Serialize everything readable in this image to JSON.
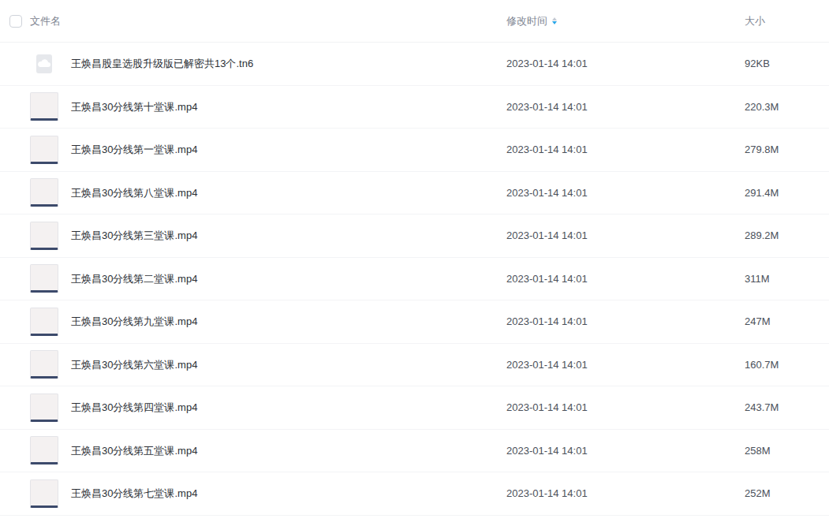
{
  "table": {
    "header_checkbox": {
      "checked": false
    },
    "columns": [
      {
        "label": "文件名",
        "sorted": false
      },
      {
        "label": "修改时间",
        "sorted": true
      },
      {
        "label": "大小",
        "sorted": false
      }
    ],
    "sort_direction": "desc",
    "rows": [
      {
        "kind": "file",
        "name": "王焕昌股皇选股升级版已解密共13个.tn6",
        "modified": "2023-01-14 14:01",
        "size": "92KB"
      },
      {
        "kind": "video",
        "name": "王焕昌30分线第十堂课.mp4",
        "modified": "2023-01-14 14:01",
        "size": "220.3M"
      },
      {
        "kind": "video",
        "name": "王焕昌30分线第一堂课.mp4",
        "modified": "2023-01-14 14:01",
        "size": "279.8M"
      },
      {
        "kind": "video",
        "name": "王焕昌30分线第八堂课.mp4",
        "modified": "2023-01-14 14:01",
        "size": "291.4M"
      },
      {
        "kind": "video",
        "name": "王焕昌30分线第三堂课.mp4",
        "modified": "2023-01-14 14:01",
        "size": "289.2M"
      },
      {
        "kind": "video",
        "name": "王焕昌30分线第二堂课.mp4",
        "modified": "2023-01-14 14:01",
        "size": "311M"
      },
      {
        "kind": "video",
        "name": "王焕昌30分线第九堂课.mp4",
        "modified": "2023-01-14 14:01",
        "size": "247M"
      },
      {
        "kind": "video",
        "name": "王焕昌30分线第六堂课.mp4",
        "modified": "2023-01-14 14:01",
        "size": "160.7M"
      },
      {
        "kind": "video",
        "name": "王焕昌30分线第四堂课.mp4",
        "modified": "2023-01-14 14:01",
        "size": "243.7M"
      },
      {
        "kind": "video",
        "name": "王焕昌30分线第五堂课.mp4",
        "modified": "2023-01-14 14:01",
        "size": "258M"
      },
      {
        "kind": "video",
        "name": "王焕昌30分线第七堂课.mp4",
        "modified": "2023-01-14 14:01",
        "size": "252M"
      }
    ]
  }
}
